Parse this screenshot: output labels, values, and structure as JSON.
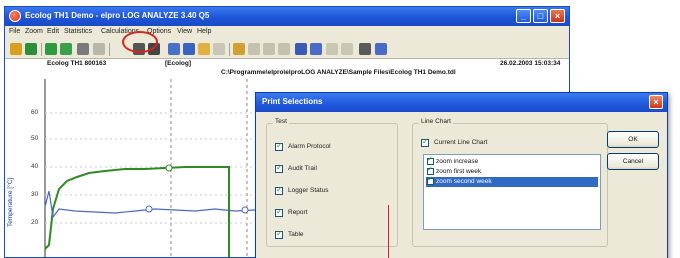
{
  "app": {
    "title": "Ecolog TH1 Demo - elpro LOG ANALYZE 3.40 Q5",
    "controls": {
      "minimize": "_",
      "maximize": "□",
      "close": "×"
    }
  },
  "menu": [
    "File",
    "Zoom",
    "Edit",
    "Statistics",
    "Calculations",
    "Options",
    "View",
    "Help"
  ],
  "toolbar": {
    "icons": [
      "open-icon",
      "save-icon",
      "chart-icon",
      "table-icon",
      "logger-icon",
      "export-icon",
      "print-preview-icon",
      "print-icon",
      "settings-icon",
      "grid-icon",
      "copy-icon",
      "paste-icon",
      "zoom-in-icon",
      "zoom-out-icon",
      "cursor-icon",
      "select-icon",
      "alarm-icon",
      "undo-icon",
      "redo-icon",
      "info-icon",
      "calendar-icon",
      "help-icon"
    ],
    "highlight_color": "#d9241c"
  },
  "chart": {
    "header_left": "Ecolog TH1 800163",
    "header_mid": "[Ecolog]",
    "header_date": "26.02.2003  15:03:34",
    "header_path": "C:\\Programme\\elpro\\elproLOG ANALYZE\\Sample Files\\Ecolog TH1 Demo.tdl",
    "y_label": "Temperature [°C]",
    "y_ticks": [
      "60",
      "50",
      "40",
      "30",
      "20"
    ],
    "colors": {
      "series_green": "#2e8b22",
      "series_blue": "#4a68c8",
      "grid": "#8a8a8a"
    }
  },
  "dialog": {
    "title": "Print Selections",
    "close": "×",
    "test_group": {
      "label": "Test",
      "items": [
        "Alarm Protocol",
        "Audit Trail",
        "Logger Status",
        "Report",
        "Table"
      ]
    },
    "line_chart_group": {
      "label": "Line Chart",
      "current_option": "Current Line Chart",
      "list": [
        {
          "label": "zoom increase",
          "selected": false
        },
        {
          "label": "zoom first week",
          "selected": false
        },
        {
          "label": "zoom second week",
          "selected": true
        }
      ]
    },
    "ok_label": "OK",
    "cancel_label": "Cancel",
    "selection_color": "#316ac5"
  }
}
